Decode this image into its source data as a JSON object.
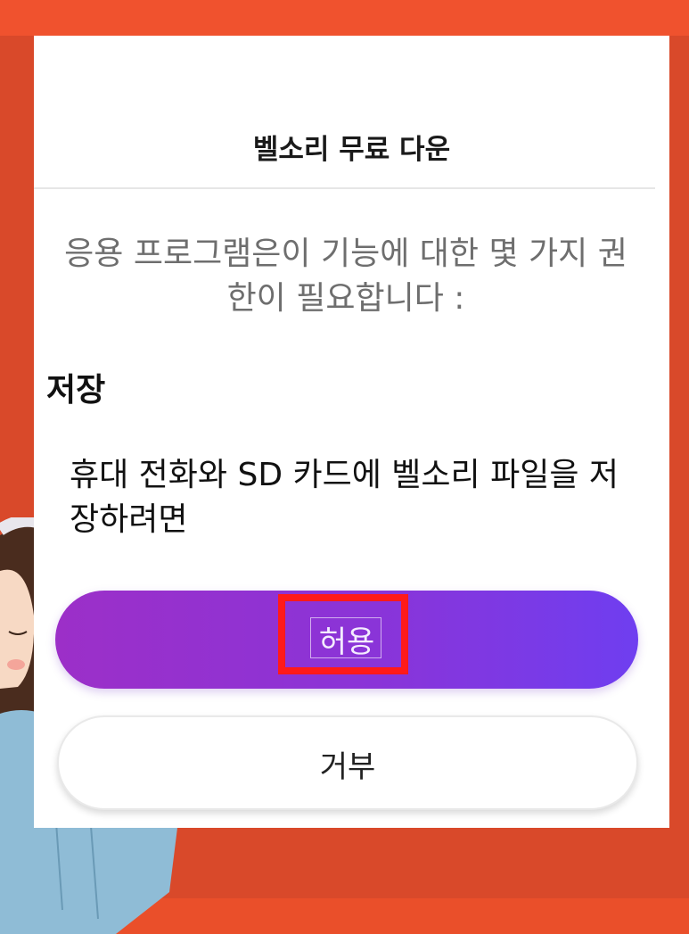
{
  "dialog": {
    "title": "벨소리 무료 다운",
    "message": "응용 프로그램은이 기능에 대한 몇 가지 권한이 필요합니다 :",
    "permission": {
      "title": "저장",
      "description": "휴대 전화와 SD 카드에 벨소리 파일을 저장하려면"
    },
    "allow_label": "허용",
    "deny_label": "거부"
  },
  "colors": {
    "frame": "#f0522e",
    "button_gradient_start": "#9c2fc8",
    "button_gradient_end": "#6f3ef0",
    "highlight": "#ff1a1a"
  },
  "icons": {
    "illustration": "girl-with-headphones-illustration"
  }
}
